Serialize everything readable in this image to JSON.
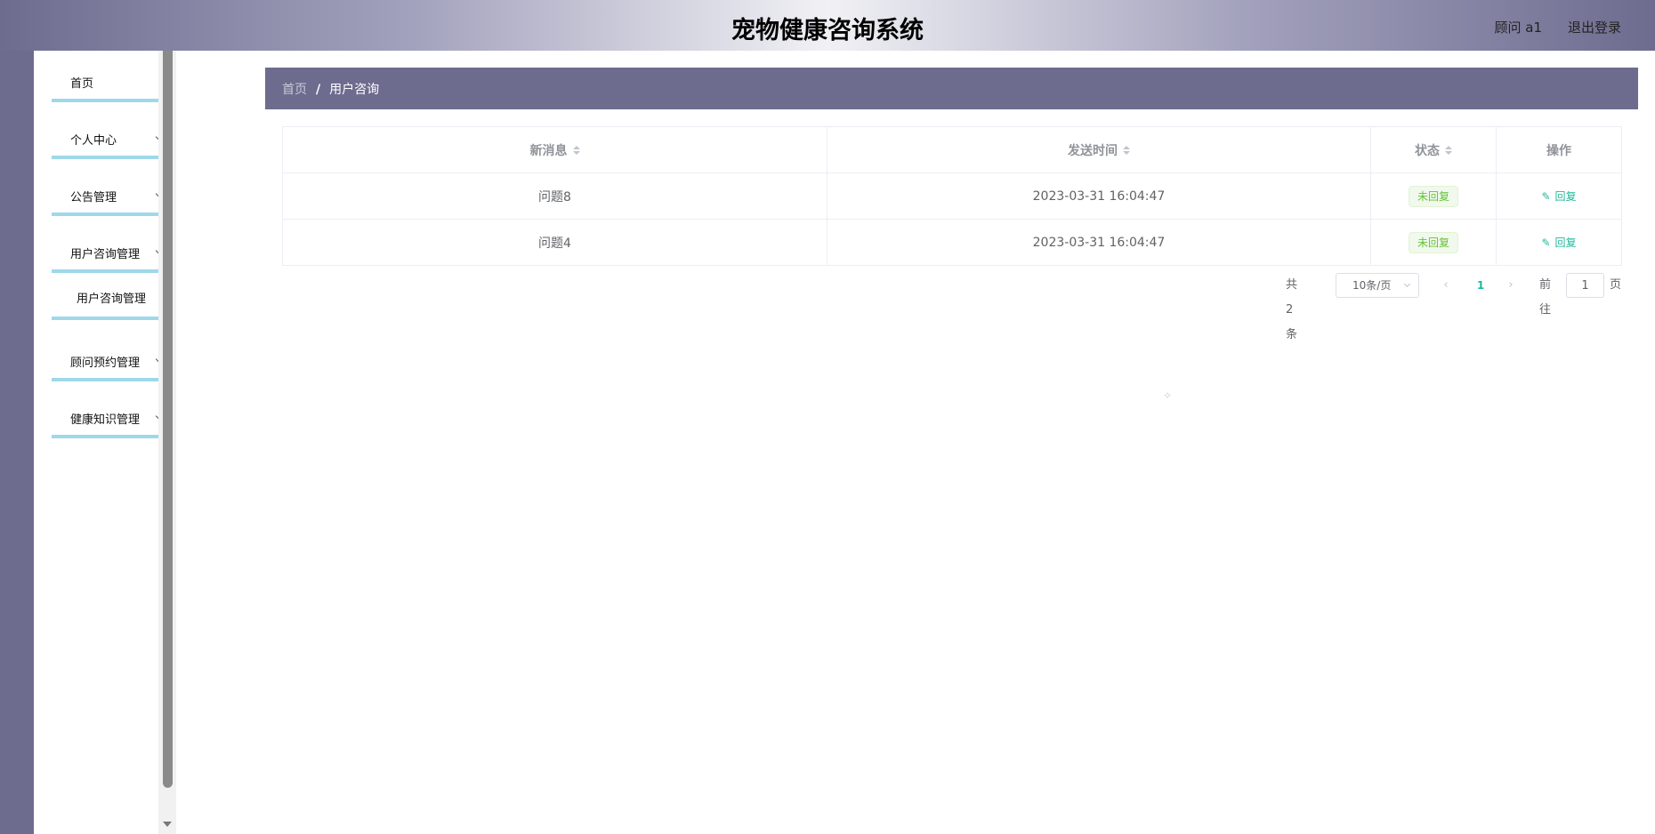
{
  "header": {
    "title": "宠物健康咨询系统",
    "user": "顾问 a1",
    "logout": "退出登录"
  },
  "sidebar": {
    "items": [
      {
        "label": "首页"
      },
      {
        "label": "个人中心"
      },
      {
        "label": "公告管理"
      },
      {
        "label": "用户咨询管理"
      },
      {
        "label": "用户咨询管理"
      },
      {
        "label": "顾问预约管理"
      },
      {
        "label": "健康知识管理"
      }
    ]
  },
  "breadcrumb": {
    "home": "首页",
    "separator": "/",
    "current": "用户咨询"
  },
  "table": {
    "headers": [
      "新消息",
      "发送时间",
      "状态",
      "操作"
    ],
    "rows": [
      {
        "message": "问题8",
        "time": "2023-03-31 16:04:47",
        "status": "未回复",
        "action": "回复"
      },
      {
        "message": "问题4",
        "time": "2023-03-31 16:04:47",
        "status": "未回复",
        "action": "回复"
      }
    ]
  },
  "pagination": {
    "total": "共 2 条",
    "page_size": "10条/页",
    "current_page": "1",
    "goto_label": "前往",
    "goto_value": "1",
    "goto_unit": "页"
  },
  "colors": {
    "theme": "#6d6c8f",
    "menu_border": "#9fd8ea",
    "accent": "#22b99a",
    "status": "#67c23a"
  }
}
